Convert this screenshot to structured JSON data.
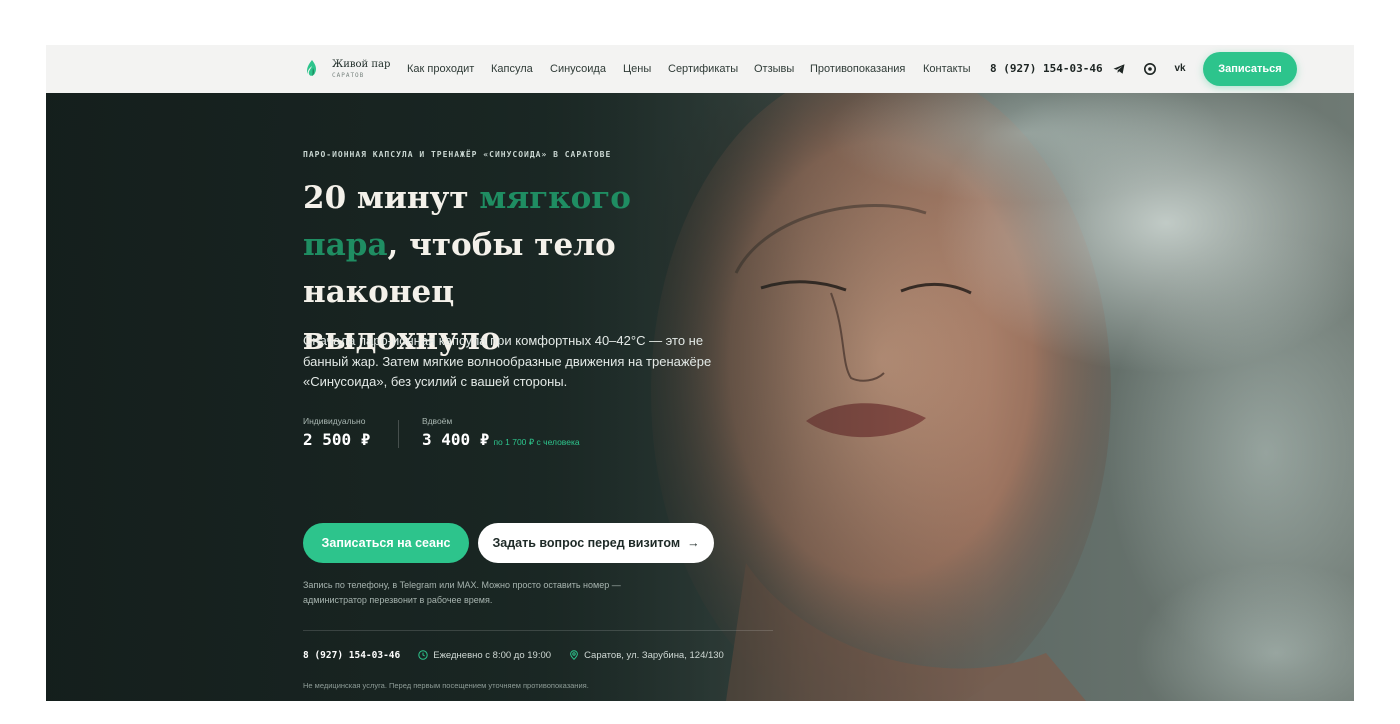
{
  "header": {
    "logo": {
      "name": "Живой пар",
      "city": "САРАТОВ"
    },
    "nav": [
      {
        "label": "Как проходит"
      },
      {
        "label": "Капсула"
      },
      {
        "label": "Синусоида"
      },
      {
        "label": "Цены"
      },
      {
        "label": "Сертификаты"
      },
      {
        "label": "Отзывы"
      },
      {
        "label": "Противопоказания"
      },
      {
        "label": "Контакты"
      }
    ],
    "phone": "8 (927) 154-03-46",
    "social": {
      "telegram": "telegram-icon",
      "max": "max-icon",
      "vk": "vk"
    },
    "cta": "Записаться"
  },
  "hero": {
    "eyebrow": "ПАРО-ИОННАЯ КАПСУЛА И ТРЕНАЖЁР «СИНУСОИДА» В САРАТОВЕ",
    "headline": {
      "part1": "20 минут ",
      "accent1": "мягкого",
      "accent2": "пара",
      "part2": ", чтобы тело",
      "line3": "наконец выдохнуло"
    },
    "lead": "Сначала паро-ионная капсула при комфортных 40–42°С — это не банный жар. Затем мягкие волнообразные движения на тренажёре «Синусоида», без усилий с вашей стороны.",
    "prices": [
      {
        "label": "Индивидуально",
        "value": "2 500 ₽"
      },
      {
        "label": "Вдвоём",
        "value": "3 400 ₽",
        "note": "по 1 700 ₽ с человека"
      }
    ],
    "primary_button": "Записаться на сеанс",
    "secondary_button": "Задать вопрос перед визитом",
    "secondary_arrow": "→",
    "contact_note": "Запись по телефону, в Telegram или MAX. Можно просто оставить номер — администратор перезвонит в рабочее время.",
    "info": {
      "phone": "8 (927) 154-03-46",
      "hours": "Ежедневно с 8:00 до 19:00",
      "address": "Саратов, ул. Зарубина, 124/130"
    },
    "disclaimer": "Не медицинская услуга. Перед первым посещением уточняем противопоказания."
  },
  "colors": {
    "accent": "#2dc48c",
    "accent_dark": "#1f8d62",
    "hero_bg": "#1a2623",
    "header_bg": "#f3f3f2"
  }
}
